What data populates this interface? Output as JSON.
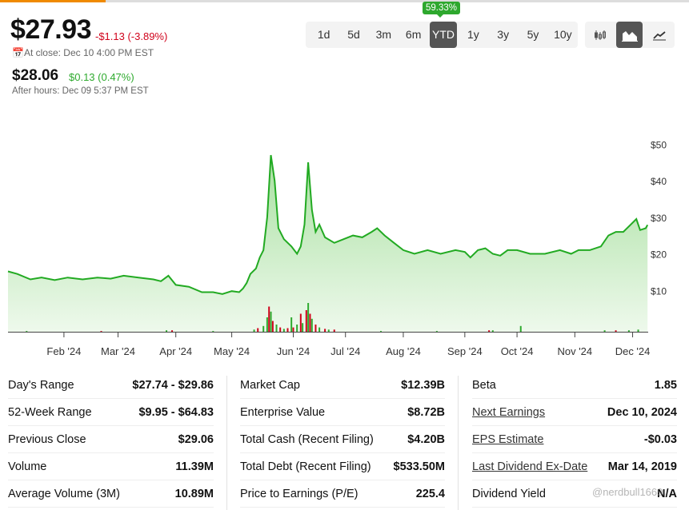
{
  "header": {
    "price": "$27.93",
    "change": "-$1.13 (-3.89%)",
    "close_time": "At close: Dec 10 4:00 PM EST",
    "after_price": "$28.06",
    "after_change": "$0.13 (0.47%)",
    "after_time": "After hours: Dec 09 5:37 PM EST"
  },
  "ranges": {
    "items": [
      "1d",
      "5d",
      "3m",
      "6m",
      "YTD",
      "1y",
      "3y",
      "5y",
      "10y"
    ],
    "active": "YTD",
    "tooltip": "59.33%"
  },
  "chart_types": [
    "candlestick-icon",
    "area-chart-icon",
    "line-chart-icon"
  ],
  "chart_data": {
    "type": "area",
    "x_unit": "days since Jan 2 2024",
    "ylim": [
      0,
      50
    ],
    "yticks": [
      "$10",
      "$20",
      "$30",
      "$40",
      "$50"
    ],
    "ytick_values": [
      10,
      20,
      30,
      40,
      50
    ],
    "xticks": [
      {
        "label": "Feb '24",
        "day": 30
      },
      {
        "label": "Mar '24",
        "day": 59
      },
      {
        "label": "Apr '24",
        "day": 90
      },
      {
        "label": "May '24",
        "day": 120
      },
      {
        "label": "Jun '24",
        "day": 153
      },
      {
        "label": "Jul '24",
        "day": 181
      },
      {
        "label": "Aug '24",
        "day": 212
      },
      {
        "label": "Sep '24",
        "day": 245
      },
      {
        "label": "Oct '24",
        "day": 273
      },
      {
        "label": "Nov '24",
        "day": 304
      },
      {
        "label": "Dec '24",
        "day": 335
      }
    ],
    "price": [
      [
        0,
        15.2
      ],
      [
        5,
        14.5
      ],
      [
        12,
        13
      ],
      [
        18,
        13.5
      ],
      [
        25,
        12.8
      ],
      [
        32,
        13.5
      ],
      [
        40,
        13
      ],
      [
        48,
        13.5
      ],
      [
        55,
        13.2
      ],
      [
        62,
        14
      ],
      [
        70,
        13.5
      ],
      [
        78,
        13
      ],
      [
        82,
        12.5
      ],
      [
        86,
        14
      ],
      [
        90,
        11.5
      ],
      [
        97,
        11
      ],
      [
        104,
        9.5
      ],
      [
        110,
        9.5
      ],
      [
        115,
        9
      ],
      [
        120,
        9.8
      ],
      [
        124,
        9.5
      ],
      [
        126,
        10.5
      ],
      [
        128,
        12
      ],
      [
        130,
        14.5
      ],
      [
        133,
        16
      ],
      [
        135,
        19
      ],
      [
        137,
        21
      ],
      [
        139,
        30
      ],
      [
        141,
        47
      ],
      [
        143,
        40
      ],
      [
        145,
        27
      ],
      [
        148,
        24
      ],
      [
        152,
        22
      ],
      [
        155,
        20
      ],
      [
        157,
        22
      ],
      [
        159,
        28
      ],
      [
        161,
        45
      ],
      [
        163,
        32
      ],
      [
        165,
        26
      ],
      [
        167,
        28
      ],
      [
        170,
        24.5
      ],
      [
        175,
        23
      ],
      [
        180,
        24
      ],
      [
        185,
        25
      ],
      [
        190,
        24.5
      ],
      [
        195,
        26
      ],
      [
        198,
        27
      ],
      [
        202,
        25
      ],
      [
        207,
        23
      ],
      [
        212,
        21
      ],
      [
        218,
        20
      ],
      [
        225,
        21
      ],
      [
        232,
        20
      ],
      [
        240,
        21
      ],
      [
        245,
        20.5
      ],
      [
        248,
        19
      ],
      [
        252,
        21
      ],
      [
        256,
        21.5
      ],
      [
        260,
        20
      ],
      [
        264,
        19.5
      ],
      [
        268,
        21
      ],
      [
        273,
        21
      ],
      [
        280,
        20
      ],
      [
        288,
        20
      ],
      [
        296,
        21
      ],
      [
        302,
        20
      ],
      [
        306,
        21
      ],
      [
        312,
        21
      ],
      [
        318,
        22
      ],
      [
        322,
        25
      ],
      [
        326,
        26
      ],
      [
        330,
        26
      ],
      [
        334,
        28
      ],
      [
        337,
        29.5
      ],
      [
        339,
        26.5
      ],
      [
        342,
        27
      ],
      [
        343,
        27.9
      ]
    ],
    "volume": [
      [
        10,
        1,
        1
      ],
      [
        50,
        1,
        0
      ],
      [
        85,
        2,
        1
      ],
      [
        88,
        2,
        0
      ],
      [
        110,
        1,
        1
      ],
      [
        132,
        3,
        1
      ],
      [
        134,
        5,
        0
      ],
      [
        137,
        8,
        1
      ],
      [
        139,
        20,
        1
      ],
      [
        140,
        35,
        0
      ],
      [
        141,
        28,
        1
      ],
      [
        142,
        15,
        0
      ],
      [
        144,
        10,
        1
      ],
      [
        146,
        6,
        0
      ],
      [
        148,
        4,
        1
      ],
      [
        150,
        5,
        0
      ],
      [
        152,
        20,
        1
      ],
      [
        153,
        6,
        0
      ],
      [
        155,
        10,
        1
      ],
      [
        157,
        25,
        0
      ],
      [
        158,
        12,
        1
      ],
      [
        160,
        30,
        0
      ],
      [
        161,
        40,
        1
      ],
      [
        162,
        25,
        0
      ],
      [
        163,
        18,
        1
      ],
      [
        165,
        10,
        0
      ],
      [
        167,
        6,
        1
      ],
      [
        170,
        4,
        0
      ],
      [
        172,
        3,
        1
      ],
      [
        175,
        3,
        0
      ],
      [
        200,
        1,
        1
      ],
      [
        230,
        1,
        1
      ],
      [
        258,
        2,
        0
      ],
      [
        260,
        2,
        1
      ],
      [
        275,
        8,
        1
      ],
      [
        320,
        2,
        1
      ],
      [
        326,
        2,
        0
      ],
      [
        333,
        2,
        1
      ],
      [
        338,
        3,
        1
      ]
    ],
    "colors": {
      "line": "#22aa22",
      "fill_top": "#a8e0a0",
      "fill_bottom": "#eef9ec",
      "up": "#2eaa2e",
      "down": "#d0021b"
    }
  },
  "stats": [
    [
      {
        "label": "Day's Range",
        "value": "$27.74 - $29.86"
      },
      {
        "label": "52-Week Range",
        "value": "$9.95 - $64.83"
      },
      {
        "label": "Previous Close",
        "value": "$29.06"
      },
      {
        "label": "Volume",
        "value": "11.39M"
      },
      {
        "label": "Average Volume (3M)",
        "value": "10.89M"
      }
    ],
    [
      {
        "label": "Market Cap",
        "value": "$12.39B"
      },
      {
        "label": "Enterprise Value",
        "value": "$8.72B"
      },
      {
        "label": "Total Cash (Recent Filing)",
        "value": "$4.20B"
      },
      {
        "label": "Total Debt (Recent Filing)",
        "value": "$533.50M"
      },
      {
        "label": "Price to Earnings (P/E)",
        "value": "225.4"
      }
    ],
    [
      {
        "label": "Beta",
        "value": "1.85"
      },
      {
        "label": "Next Earnings",
        "value": "Dec 10, 2024",
        "link": true
      },
      {
        "label": "EPS Estimate",
        "value": "-$0.03",
        "link": true
      },
      {
        "label": "Last Dividend Ex-Date",
        "value": "Mar 14, 2019",
        "link": true
      },
      {
        "label": "Dividend Yield",
        "value": "N/A"
      }
    ]
  ],
  "watermark": "@nerdbull1669"
}
